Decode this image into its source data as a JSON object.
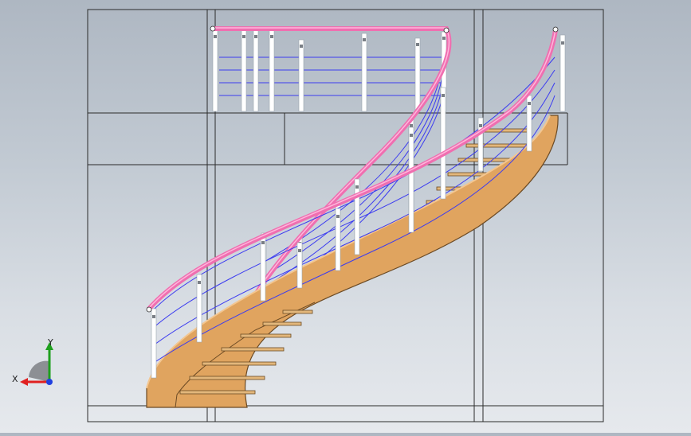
{
  "viewport": {
    "model": "curved-staircase-with-glass-cable-railing",
    "view": "front-orthographic",
    "background_top": "#aeb7c2",
    "background_bottom": "#e6e9ed"
  },
  "colors": {
    "edge": "#2b2b2b",
    "handrail": "#ef6fb0",
    "handrail_highlight": "#ffb6dc",
    "cable": "#3c3cf0",
    "stringer_face": "#e0a45f",
    "stringer_edge": "#6b4a24",
    "tread": "#e3b77b",
    "baluster": "#ffffff",
    "axis_x": "#e02020",
    "axis_y": "#1ea01e",
    "axis_z": "#2040e0"
  },
  "axes": {
    "x_label": "X",
    "y_label": "Y",
    "x_icon": "axis-x-arrow-icon",
    "y_icon": "axis-y-arrow-icon",
    "z_icon": "axis-z-dot-icon"
  }
}
